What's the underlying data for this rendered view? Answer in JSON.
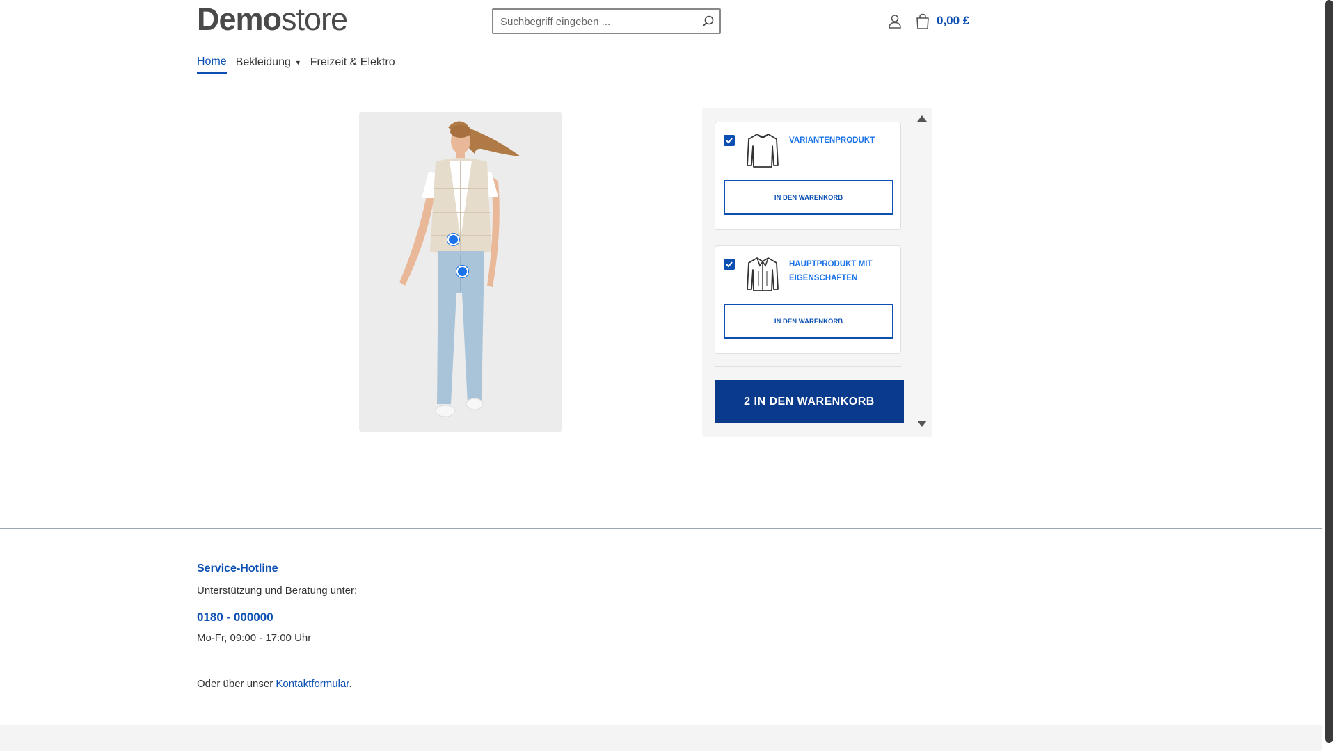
{
  "header": {
    "logo_bold": "Demo",
    "logo_light": "store",
    "search_placeholder": "Suchbegriff eingeben ...",
    "cart_total": "0,00 £"
  },
  "nav": {
    "home": "Home",
    "bekleidung": "Bekleidung",
    "freizeit": "Freizeit & Elektro"
  },
  "cross_selling": {
    "items": [
      {
        "name": "Variantenprodukt",
        "checked": true,
        "add_label": "In den Warenkorb",
        "icon": "long-sleeve-shirt-icon"
      },
      {
        "name": "Hauptprodukt mit Eigenschaften",
        "checked": true,
        "add_label": "In den Warenkorb",
        "icon": "jacket-icon"
      }
    ],
    "bulk_add_label": "2 IN DEN WARENKORB"
  },
  "footer": {
    "hotline_title": "Service-Hotline",
    "hotline_sub": "Unterstützung und Beratung unter:",
    "phone": "0180 - 000000",
    "hours": "Mo-Fr, 09:00 - 17:00 Uhr",
    "contact_prefix": "Oder über unser ",
    "contact_link": "Kontaktformular",
    "contact_suffix": "."
  },
  "colors": {
    "brand_blue": "#0b4fb3",
    "button_dark_blue": "#0a3a8c",
    "link_blue": "#1a73e8"
  }
}
